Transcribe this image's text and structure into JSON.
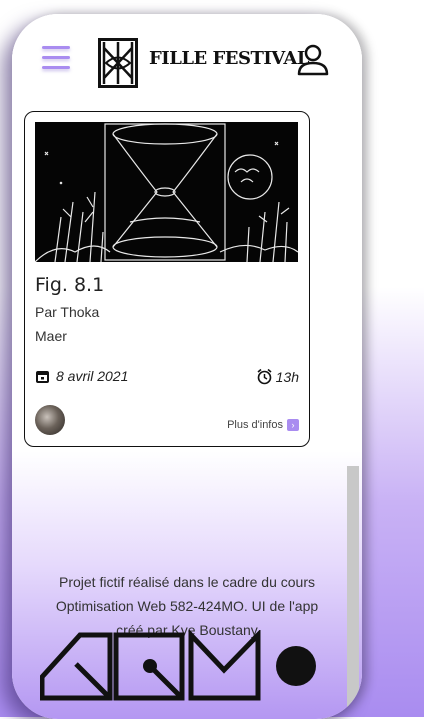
{
  "header": {
    "brand": "FILLE FESTIVAL"
  },
  "card": {
    "title": "Fig. 8.1",
    "by": "Par Thoka",
    "name": "Maer",
    "date": "8 avril 2021",
    "time": "13h",
    "more_label": "Plus d'infos"
  },
  "footer": {
    "line1": "Projet fictif réalisé dans le cadre du cours",
    "line2": "Optimisation Web 582-424MO. UI de l'app",
    "line3": "créé par Kye Boustany"
  },
  "colors": {
    "accent": "#a98cf0",
    "ink": "#111111"
  }
}
